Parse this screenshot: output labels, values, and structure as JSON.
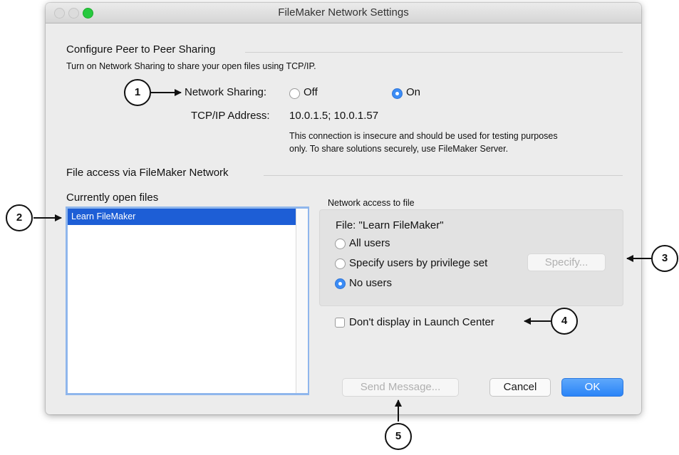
{
  "window": {
    "title": "FileMaker Network Settings"
  },
  "peer_sharing": {
    "heading": "Configure Peer to Peer Sharing",
    "description": "Turn on Network Sharing to share your open files using TCP/IP.",
    "network_sharing_label": "Network Sharing:",
    "off_label": "Off",
    "on_label": "On",
    "selected": "On",
    "tcpip_label": "TCP/IP Address:",
    "tcpip_value": "10.0.1.5; 10.0.1.57",
    "warning_line1": "This connection is insecure and should be used for testing purposes",
    "warning_line2": "only. To share solutions securely, use FileMaker Server."
  },
  "file_access": {
    "heading": "File access via FileMaker Network",
    "open_files_label": "Currently open files",
    "open_files": [
      "Learn FileMaker"
    ],
    "selected_file": "Learn FileMaker",
    "network_access_label": "Network access to file",
    "file_label": "File: \"Learn FileMaker\"",
    "options": [
      "All users",
      "Specify users by privilege set",
      "No users"
    ],
    "selected_option": "No users",
    "specify_button": "Specify...",
    "launch_center_checkbox": "Don't display in Launch Center",
    "launch_center_checked": false
  },
  "buttons": {
    "send_message": "Send Message...",
    "cancel": "Cancel",
    "ok": "OK"
  },
  "callouts": [
    "1",
    "2",
    "3",
    "4",
    "5"
  ],
  "colors": {
    "accent": "#3b8cf5",
    "selection": "#1d5ed6",
    "window_bg": "#ececec"
  }
}
